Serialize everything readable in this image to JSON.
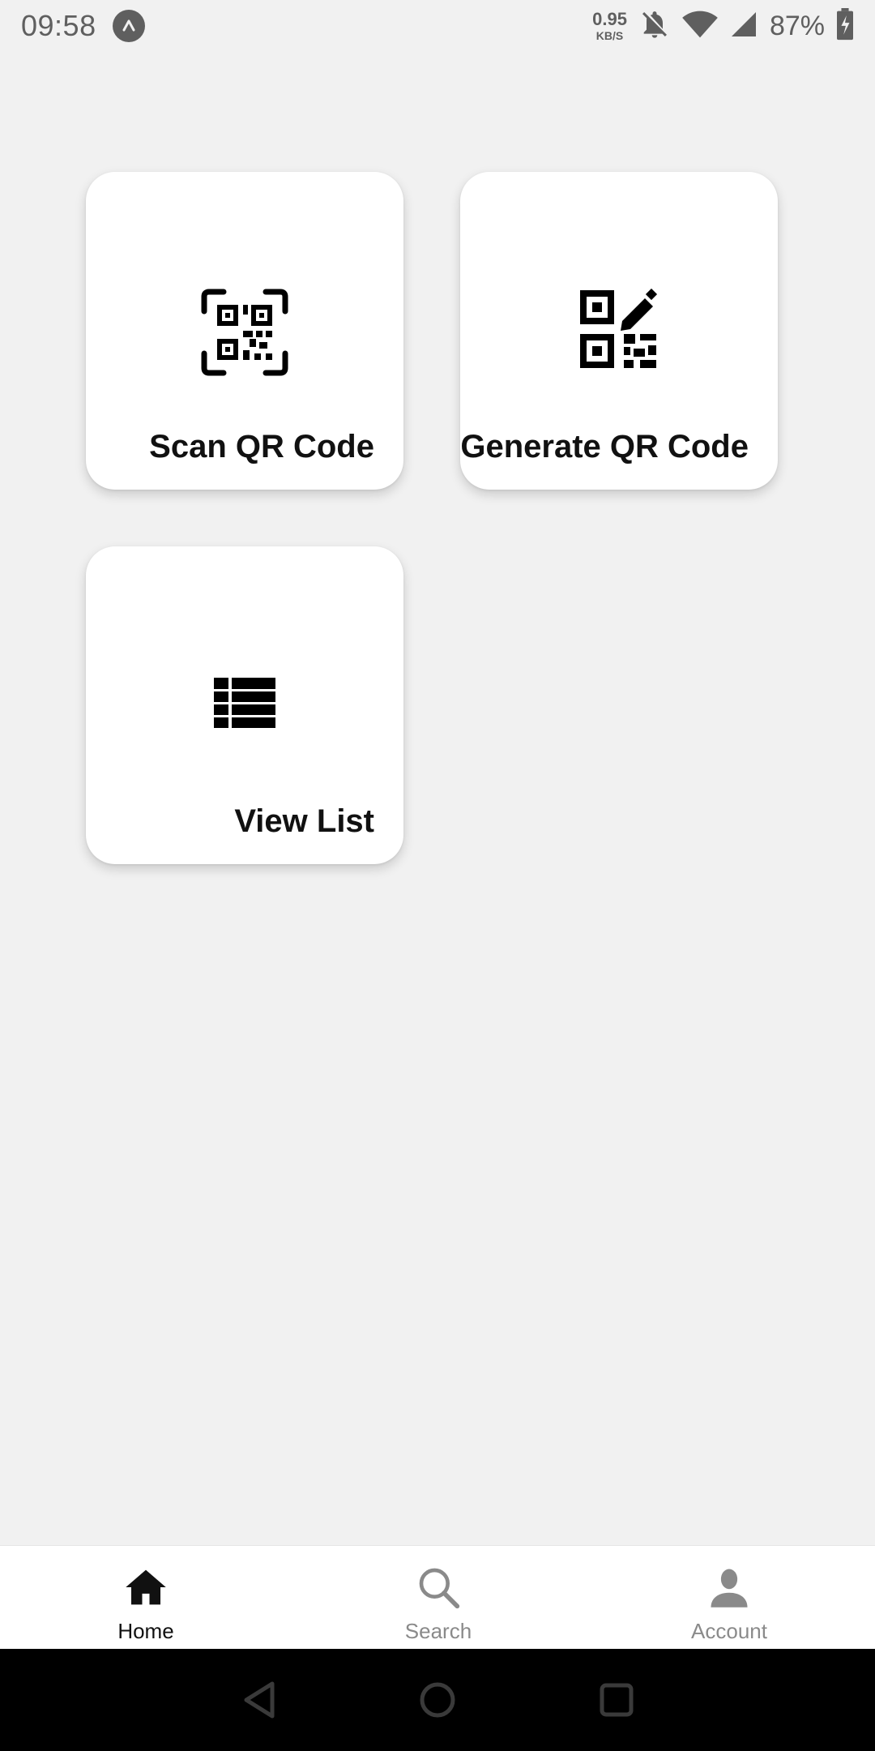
{
  "status_bar": {
    "time": "09:58",
    "net_speed_value": "0.95",
    "net_speed_unit": "KB/S",
    "battery": "87%",
    "icons": [
      "app-notification-icon",
      "bell-off-icon",
      "wifi-icon",
      "cell-signal-icon",
      "battery-icon"
    ]
  },
  "tiles": [
    {
      "label": "Scan QR Code",
      "icon": "qr-scan-icon"
    },
    {
      "label": "Generate QR Code",
      "icon": "qr-edit-icon"
    },
    {
      "label": "View List",
      "icon": "list-icon"
    }
  ],
  "bottom_nav": {
    "items": [
      {
        "label": "Home",
        "icon": "home-icon",
        "active": true
      },
      {
        "label": "Search",
        "icon": "search-icon",
        "active": false
      },
      {
        "label": "Account",
        "icon": "account-icon",
        "active": false
      }
    ]
  },
  "system_nav": {
    "icons": [
      "back-icon",
      "home-circle-icon",
      "recents-icon"
    ]
  },
  "colors": {
    "background": "#f1f1f1",
    "card": "#ffffff",
    "text": "#111111",
    "inactive": "#8a8a8a",
    "status": "#5f5f5f",
    "system_nav": "#000000"
  }
}
